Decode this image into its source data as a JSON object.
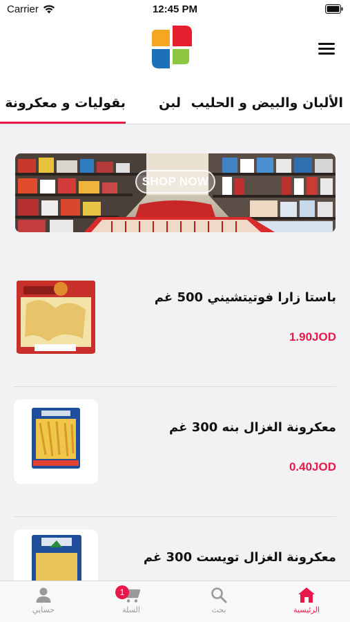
{
  "status_bar": {
    "carrier": "Carrier",
    "time": "12:45 PM"
  },
  "categories": {
    "tabs": [
      {
        "label": "الألبان والبيض و الحليب"
      },
      {
        "label": "لبن"
      },
      {
        "label": "بقوليات و معكرونة و غ"
      }
    ],
    "active_index": 2
  },
  "banner": {
    "cta": "SHOP NOW"
  },
  "products": [
    {
      "name": "باستا زارا فوتيتشيني 500 غم",
      "price": "1.90JOD"
    },
    {
      "name": "معكرونة الغزال بنه 300 غم",
      "price": "0.40JOD"
    },
    {
      "name": "معكرونة الغزال تويست 300 غم"
    }
  ],
  "tabbar": {
    "items": [
      {
        "label": "الرئيسية",
        "icon": "home-icon"
      },
      {
        "label": "بحث",
        "icon": "search-icon"
      },
      {
        "label": "السلة",
        "icon": "cart-icon",
        "badge": "1"
      },
      {
        "label": "حسابي",
        "icon": "user-icon"
      }
    ]
  },
  "colors": {
    "accent": "#e8184a",
    "tab_inactive": "#9a9a9a"
  }
}
